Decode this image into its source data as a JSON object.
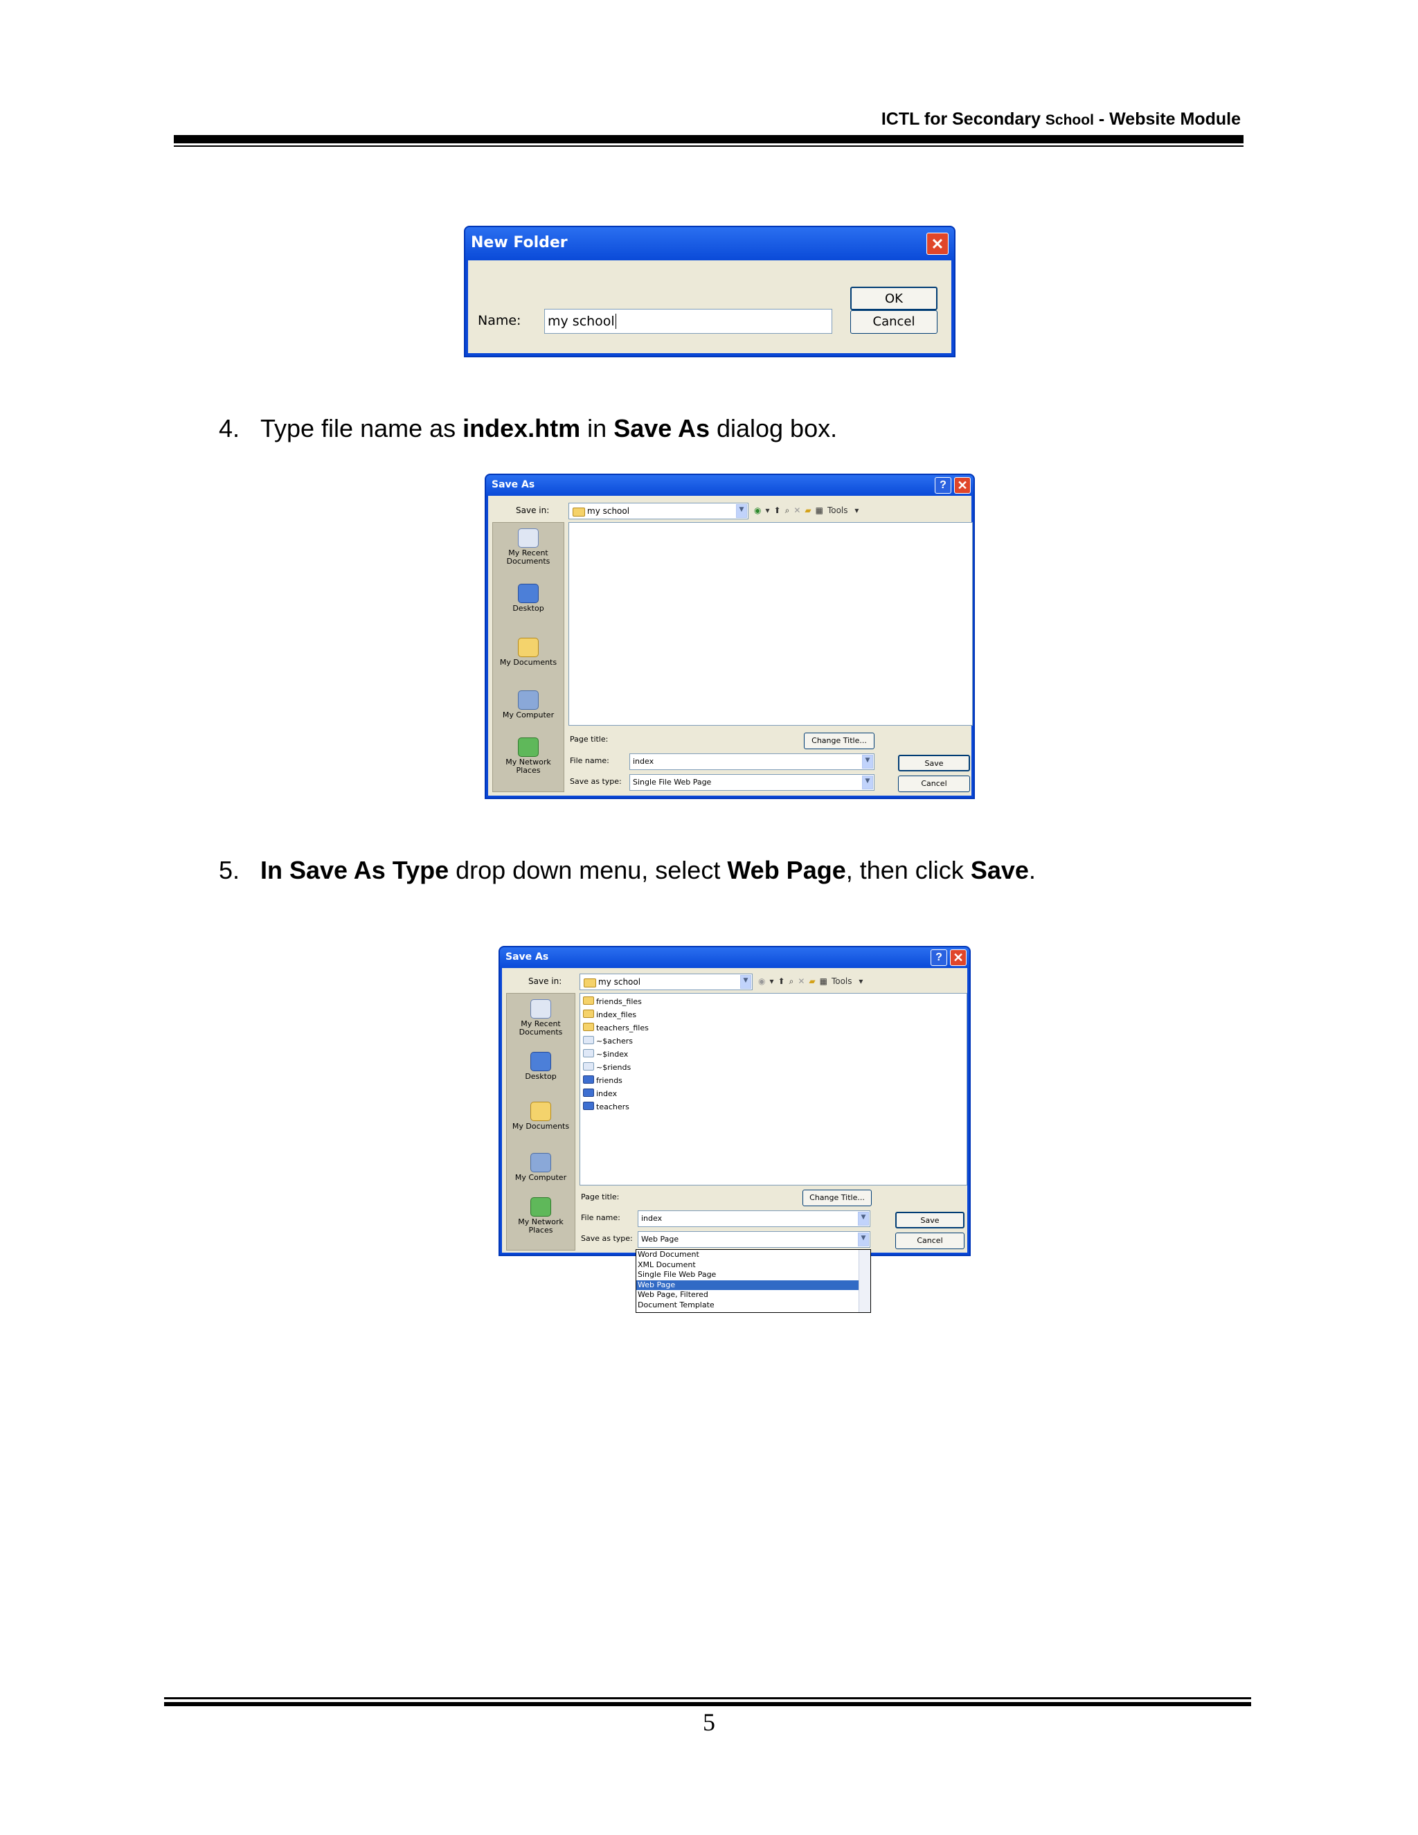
{
  "header": {
    "part1": "ICTL for  Secondary ",
    "part2": "School",
    "part3": " -  Website Module"
  },
  "new_folder_dialog": {
    "title": "New Folder",
    "close_glyph": "✕",
    "name_label": "Name:",
    "name_value": "my school",
    "ok_label": "OK",
    "cancel_label": "Cancel"
  },
  "steps": [
    {
      "num": "4.",
      "t1": "Type file name as ",
      "b1": "index.htm",
      "t2": " in ",
      "b2": "Save As",
      "t3": " dialog box."
    },
    {
      "num": "5.",
      "b1": "In Save As Type",
      "t1": " drop down menu, select ",
      "b2": "Web Page",
      "t2": ", then click ",
      "b3": "Save",
      "t3": "."
    }
  ],
  "save_as_1": {
    "title": "Save As",
    "help_glyph": "?",
    "close_glyph": "✕",
    "save_in_label": "Save in:",
    "save_in_value": "my school",
    "tools_label": "Tools",
    "places": [
      "My Recent Documents",
      "Desktop",
      "My Documents",
      "My Computer",
      "My Network Places"
    ],
    "page_title_label": "Page title:",
    "change_title_label": "Change Title...",
    "file_name_label": "File name:",
    "file_name_value": "index",
    "save_type_label": "Save as type:",
    "save_type_value": "Single File Web Page",
    "save_label": "Save",
    "cancel_label": "Cancel"
  },
  "save_as_2": {
    "title": "Save As",
    "help_glyph": "?",
    "close_glyph": "✕",
    "save_in_label": "Save in:",
    "save_in_value": "my school",
    "tools_label": "Tools",
    "places": [
      "My Recent Documents",
      "Desktop",
      "My Documents",
      "My Computer",
      "My Network Places"
    ],
    "files": [
      "friends_files",
      "index_files",
      "teachers_files",
      "~$achers",
      "~$index",
      "~$riends",
      "friends",
      "index",
      "teachers"
    ],
    "page_title_label": "Page title:",
    "change_title_label": "Change Title...",
    "file_name_label": "File name:",
    "file_name_value": "index",
    "save_type_label": "Save as type:",
    "save_type_value": "Web Page",
    "save_label": "Save",
    "cancel_label": "Cancel",
    "type_options": [
      "Word Document",
      "XML Document",
      "Single File Web Page",
      "Web Page",
      "Web Page, Filtered",
      "Document Template"
    ]
  },
  "page_number": "5"
}
